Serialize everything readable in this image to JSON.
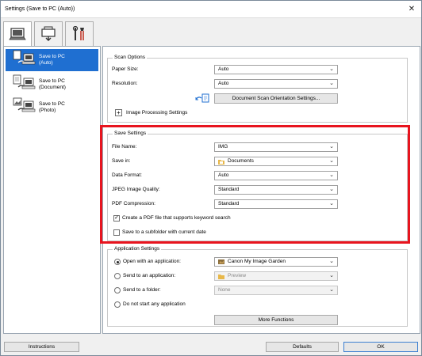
{
  "window": {
    "title": "Settings (Save to PC (Auto))",
    "close_glyph": "✕"
  },
  "tabs": [
    {
      "name": "scan-from-computer-tab",
      "icon": "computer-icon",
      "active": true
    },
    {
      "name": "scan-from-panel-tab",
      "icon": "scanner-panel-icon",
      "active": false
    },
    {
      "name": "general-settings-tab",
      "icon": "tools-icon",
      "active": false
    }
  ],
  "nav": [
    {
      "label": "Save to PC\n(Auto)",
      "selected": true
    },
    {
      "label": "Save to PC\n(Document)",
      "selected": false
    },
    {
      "label": "Save to PC\n(Photo)",
      "selected": false
    }
  ],
  "scan_options": {
    "title": "Scan Options",
    "paper_size_label": "Paper Size:",
    "paper_size_value": "Auto",
    "resolution_label": "Resolution:",
    "resolution_value": "Auto",
    "orientation_button": "Document Scan Orientation Settings...",
    "image_processing_label": "Image Processing Settings",
    "expand_glyph": "+"
  },
  "save_settings": {
    "title": "Save Settings",
    "file_name_label": "File Name:",
    "file_name_value": "IMG",
    "save_in_label": "Save in:",
    "save_in_value": "Documents",
    "data_format_label": "Data Format:",
    "data_format_value": "Auto",
    "jpeg_quality_label": "JPEG Image Quality:",
    "jpeg_quality_value": "Standard",
    "pdf_compression_label": "PDF Compression:",
    "pdf_compression_value": "Standard",
    "keyword_search_label": "Create a PDF file that supports keyword search",
    "keyword_search_checked": true,
    "subfolder_label": "Save to a subfolder with current date",
    "subfolder_checked": false,
    "check_glyph": "✓"
  },
  "application_settings": {
    "title": "Application Settings",
    "open_app_label": "Open with an application:",
    "open_app_value": "Canon My Image Garden",
    "send_app_label": "Send to an application:",
    "send_app_value": "Preview",
    "send_folder_label": "Send to a folder:",
    "send_folder_value": "None",
    "no_app_label": "Do not start any application",
    "more_functions_button": "More Functions",
    "selected_option": "open_app"
  },
  "bottom": {
    "instructions_button": "Instructions",
    "defaults_button": "Defaults",
    "ok_button": "OK"
  },
  "caret_glyph": "⌄",
  "colors": {
    "highlight": "#e8141e",
    "selection": "#1f6fd1"
  }
}
